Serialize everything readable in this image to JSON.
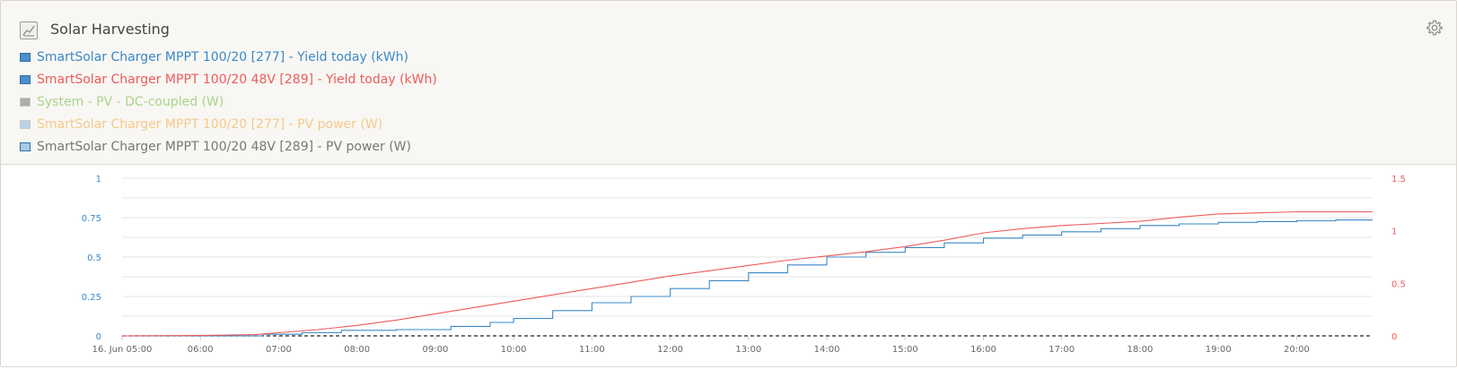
{
  "widget": {
    "title": "Solar Harvesting",
    "title_icon": "line-chart-icon",
    "settings_icon": "gear-icon"
  },
  "legend": [
    {
      "label": "SmartSolar Charger MPPT 100/20 [277] - Yield today (kWh)",
      "color": "#3b88c8",
      "swatch": "#4a8fca",
      "muted": false
    },
    {
      "label": "SmartSolar Charger MPPT 100/20 48V [289] - Yield today (kWh)",
      "color": "#ee5a5a",
      "swatch": "#4a8fca",
      "muted": false
    },
    {
      "label": "System - PV - DC-coupled (W)",
      "color": "#a9d48a",
      "swatch": "#9a9a9a",
      "muted": true
    },
    {
      "label": "SmartSolar Charger MPPT 100/20 [277] - PV power (W)",
      "color": "#f5c98c",
      "swatch": "#a9c9e6",
      "muted": true
    },
    {
      "label": "SmartSolar Charger MPPT 100/20 48V [289] - PV power (W)",
      "color": "#777777",
      "swatch": "#a9c9e6",
      "muted": false
    }
  ],
  "chart_data": {
    "type": "line",
    "x_tick_labels": [
      "16. Jun 05:00",
      "06:00",
      "07:00",
      "08:00",
      "09:00",
      "10:00",
      "11:00",
      "12:00",
      "13:00",
      "14:00",
      "15:00",
      "16:00",
      "17:00",
      "18:00",
      "19:00",
      "20:00"
    ],
    "x_hours": [
      5,
      6,
      7,
      8,
      9,
      10,
      11,
      12,
      13,
      14,
      15,
      16,
      17,
      18,
      19,
      20
    ],
    "xlim_hours": [
      5,
      20.97
    ],
    "y_left": {
      "ticks": [
        "0",
        "0.25",
        "0.5",
        "0.75",
        "1"
      ],
      "lim": [
        0,
        1
      ],
      "color": "#3b88c8"
    },
    "y_right": {
      "ticks": [
        "0",
        "0.5",
        "1",
        "1.5"
      ],
      "lim": [
        0,
        1.5
      ],
      "color": "#ee5a5a"
    },
    "grid": true,
    "series": [
      {
        "name": "SmartSolar Charger MPPT 100/20 [277] - Yield today (kWh)",
        "axis": "left",
        "color": "#3b88c8",
        "step": true,
        "x": [
          5,
          6,
          6.8,
          7.3,
          7.8,
          8.5,
          9.2,
          9.7,
          10,
          10.5,
          11,
          11.5,
          12,
          12.5,
          13,
          13.5,
          14,
          14.5,
          15,
          15.5,
          16,
          16.5,
          17,
          17.5,
          18,
          18.5,
          19,
          19.5,
          20,
          20.5,
          20.97
        ],
        "y": [
          0,
          0,
          0.01,
          0.02,
          0.035,
          0.04,
          0.06,
          0.085,
          0.11,
          0.16,
          0.21,
          0.25,
          0.3,
          0.35,
          0.4,
          0.45,
          0.5,
          0.53,
          0.56,
          0.59,
          0.62,
          0.64,
          0.66,
          0.68,
          0.7,
          0.71,
          0.72,
          0.725,
          0.73,
          0.735,
          0.735
        ]
      },
      {
        "name": "SmartSolar Charger MPPT 100/20 48V [289] - Yield today (kWh)",
        "axis": "right",
        "color": "#ee5a5a",
        "step": false,
        "x": [
          5,
          6,
          6.7,
          7,
          7.5,
          8,
          8.5,
          9,
          9.5,
          10,
          10.5,
          11,
          11.5,
          12,
          12.5,
          13,
          13.5,
          14,
          14.5,
          15,
          15.5,
          16,
          16.5,
          17,
          17.5,
          18,
          18.5,
          19,
          19.5,
          20,
          20.5,
          20.97
        ],
        "y": [
          0,
          0.003,
          0.012,
          0.03,
          0.06,
          0.1,
          0.15,
          0.21,
          0.27,
          0.33,
          0.39,
          0.45,
          0.51,
          0.57,
          0.62,
          0.67,
          0.72,
          0.76,
          0.8,
          0.85,
          0.91,
          0.98,
          1.02,
          1.05,
          1.07,
          1.09,
          1.13,
          1.16,
          1.17,
          1.18,
          1.18,
          1.18
        ]
      }
    ]
  }
}
